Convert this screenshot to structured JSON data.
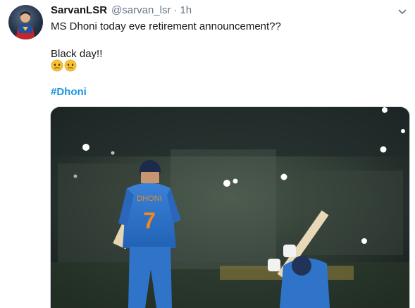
{
  "tweet": {
    "display_name": "SarvanLSR",
    "handle": "@sarvan_lsr",
    "separator": "·",
    "time": "1h",
    "lines": [
      "MS Dhoni today eve retirement announcement??",
      "Black day!!"
    ],
    "emojis": [
      "worried-face-emoji",
      "worried-face-emoji"
    ],
    "hashtag": "#Dhoni"
  },
  "media": {
    "jersey_name": "DHONI",
    "jersey_number": "7"
  },
  "colors": {
    "link": "#1b95e0",
    "secondary_text": "#657786",
    "jersey_blue": "#2f74c9",
    "jersey_orange": "#f08a1e"
  },
  "icons": [
    "avatar-superman",
    "chevron-down-icon"
  ]
}
